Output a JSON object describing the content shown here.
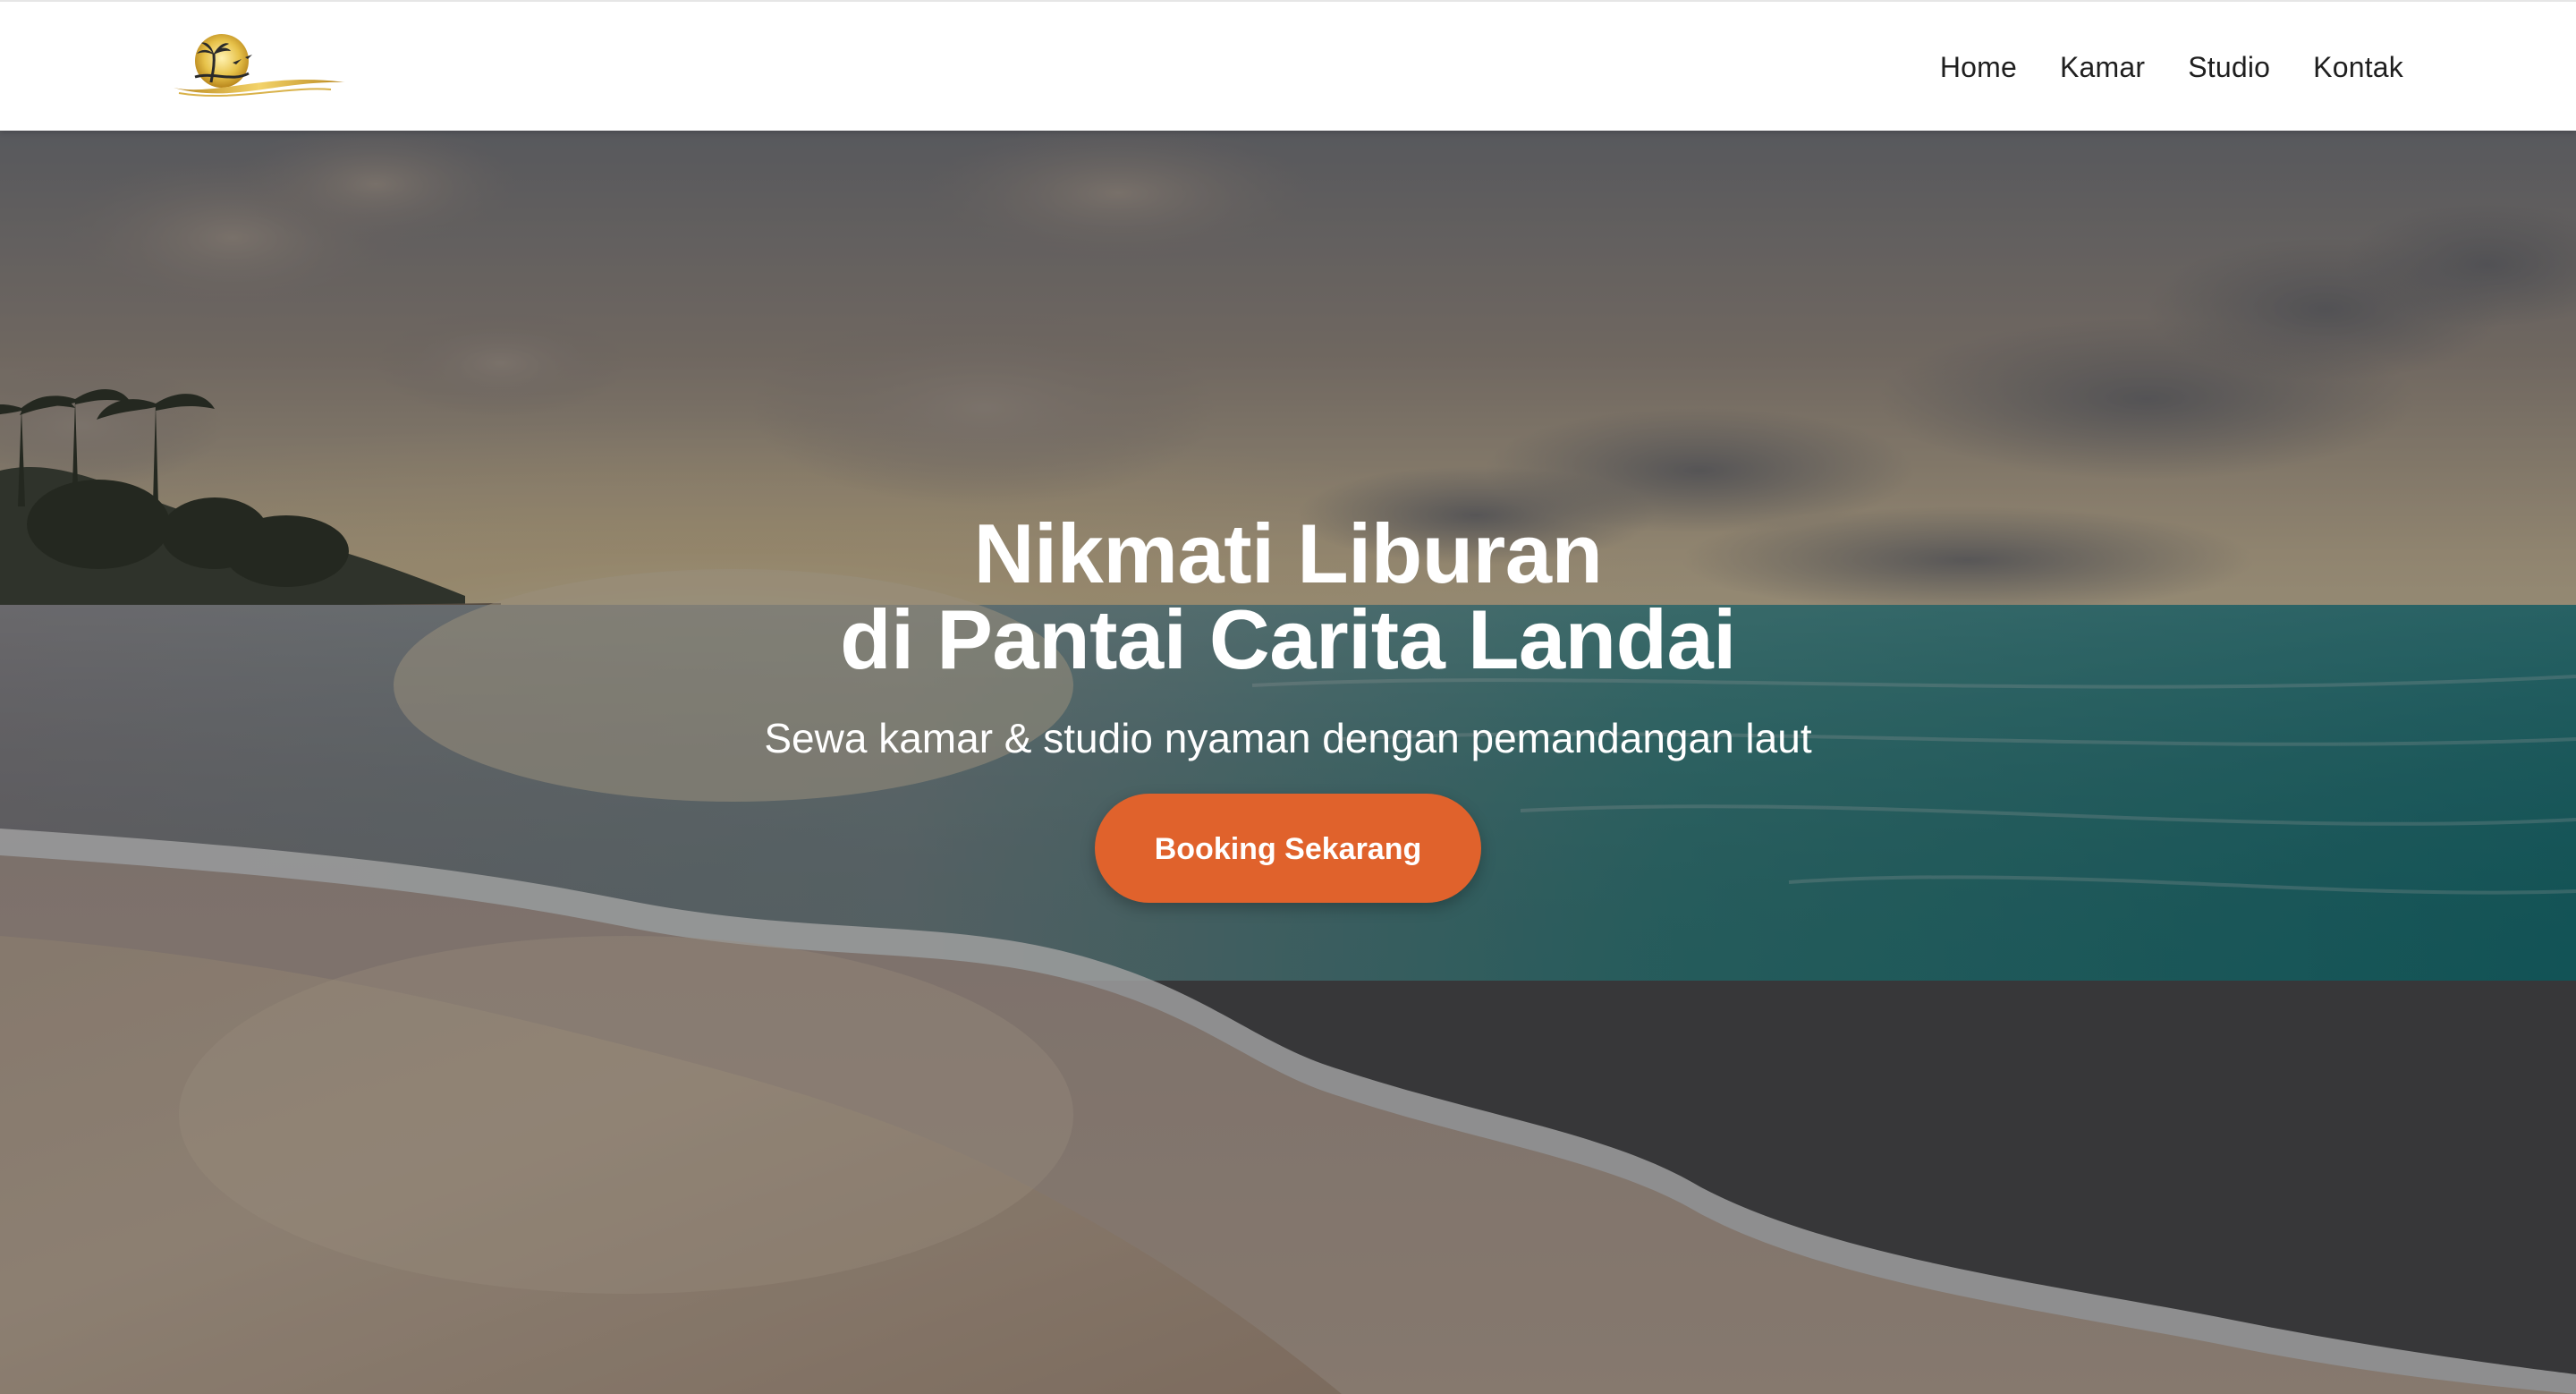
{
  "brand": {
    "logo_icon": "sunset-palm-logo",
    "logo_color": "#c9a227"
  },
  "nav": {
    "items": [
      {
        "label": "Home"
      },
      {
        "label": "Kamar"
      },
      {
        "label": "Studio"
      },
      {
        "label": "Kontak"
      }
    ]
  },
  "hero": {
    "background_icon": "beach-sunset-photo",
    "title_line1": "Nikmati Liburan",
    "title_line2": "di Pantai Carita Landai",
    "subtitle": "Sewa kamar & studio nyaman dengan pemandangan laut",
    "cta_label": "Booking Sekarang",
    "cta_color": "#e0622c"
  }
}
